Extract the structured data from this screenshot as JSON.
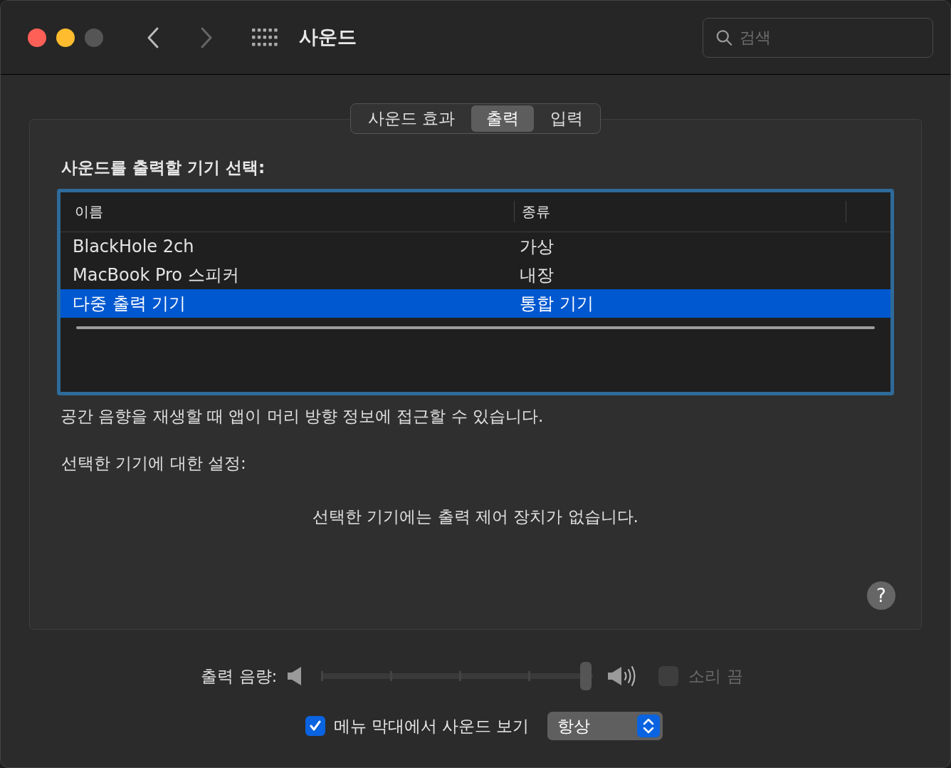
{
  "window": {
    "title": "사운드",
    "back_disabled": false,
    "forward_disabled": true
  },
  "search": {
    "placeholder": "검색"
  },
  "tabs": [
    {
      "label": "사운드 효과",
      "selected": false
    },
    {
      "label": "출력",
      "selected": true
    },
    {
      "label": "입력",
      "selected": false
    }
  ],
  "heading": "사운드를 출력할 기기 선택:",
  "table": {
    "columns": [
      "이름",
      "종류"
    ],
    "rows": [
      {
        "cells": [
          "BlackHole 2ch",
          "가상"
        ],
        "selected": false
      },
      {
        "cells": [
          "MacBook Pro 스피커",
          "내장"
        ],
        "selected": false
      },
      {
        "cells": [
          "다중 출력 기기",
          "통합 기기"
        ],
        "selected": true
      }
    ]
  },
  "spatial_note": "공간 음향을 재생할 때 앱이 머리 방향 정보에 접근할 수 있습니다.",
  "settings_label": "선택한 기기에 대한 설정:",
  "no_controls": "선택한 기기에는 출력 제어 장치가 없습니다.",
  "help": "?",
  "volume": {
    "label": "출력 음량:",
    "level": 0.98,
    "disabled": true
  },
  "mute": {
    "label": "소리 끔",
    "checked": false,
    "disabled": true
  },
  "menu_bar": {
    "label": "메뉴 막대에서 사운드 보기",
    "checked": true,
    "popup": "항상"
  }
}
